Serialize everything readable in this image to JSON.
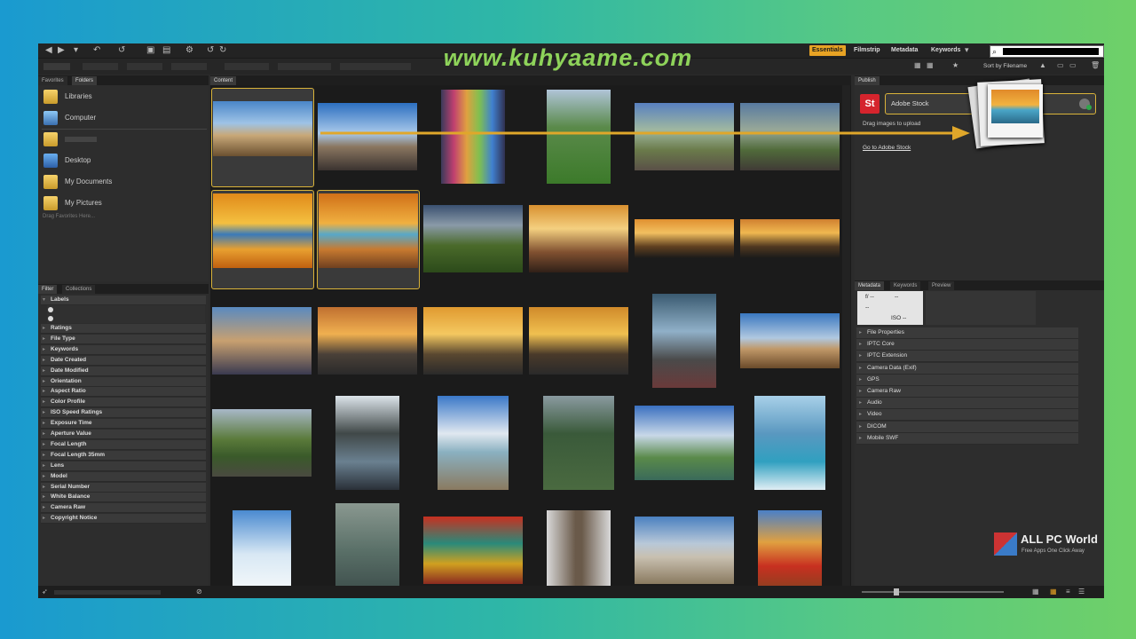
{
  "watermark": "www.kuhyaame.com",
  "workspaces": [
    "Essentials",
    "Filmstrip",
    "Metadata",
    "Keywords"
  ],
  "sort_label": "Sort by Filename",
  "left_panel": {
    "tabs": [
      "Favorites",
      "Folders"
    ],
    "favorites": [
      {
        "label": "Libraries",
        "icon": "libraries-icon"
      },
      {
        "label": "Computer",
        "icon": "computer-icon"
      },
      {
        "label": "",
        "icon": "user-folder-icon"
      },
      {
        "label": "Desktop",
        "icon": "desktop-icon"
      },
      {
        "label": "My Documents",
        "icon": "documents-icon"
      },
      {
        "label": "My Pictures",
        "icon": "pictures-icon"
      }
    ],
    "favorites_hint": "Drag Favorites Here..."
  },
  "filter_panel": {
    "tabs": [
      "Filter",
      "Collections"
    ],
    "labels_heading": "Labels",
    "items": [
      "Ratings",
      "File Type",
      "Keywords",
      "Date Created",
      "Date Modified",
      "Orientation",
      "Aspect Ratio",
      "Color Profile",
      "ISO Speed Ratings",
      "Exposure Time",
      "Aperture Value",
      "Focal Length",
      "Focal Length 35mm",
      "Lens",
      "Model",
      "Serial Number",
      "White Balance",
      "Camera Raw",
      "Copyright Notice"
    ]
  },
  "content": {
    "tab": "Content"
  },
  "publish_panel": {
    "tab": "Publish",
    "service_name": "Adobe Stock",
    "service_logo": "St",
    "hint": "Drag images to upload",
    "link": "Go to Adobe Stock"
  },
  "metadata_panel": {
    "tabs": [
      "Metadata",
      "Keywords",
      "Preview"
    ],
    "info": {
      "aperture": "f/ --",
      "shutter": "--",
      "ev": "--",
      "iso": "ISO --"
    },
    "sections": [
      "File Properties",
      "IPTC Core",
      "IPTC Extension",
      "Camera Data (Exif)",
      "GPS",
      "Camera Raw",
      "Audio",
      "Video",
      "DICOM",
      "Mobile SWF"
    ]
  },
  "corner_logo": {
    "title": "ALL PC World",
    "subtitle": "Free Apps One Click Away"
  },
  "colors": {
    "accent": "#e8a324",
    "selection": "#d9b33a",
    "watermark": "#8ed35a"
  }
}
